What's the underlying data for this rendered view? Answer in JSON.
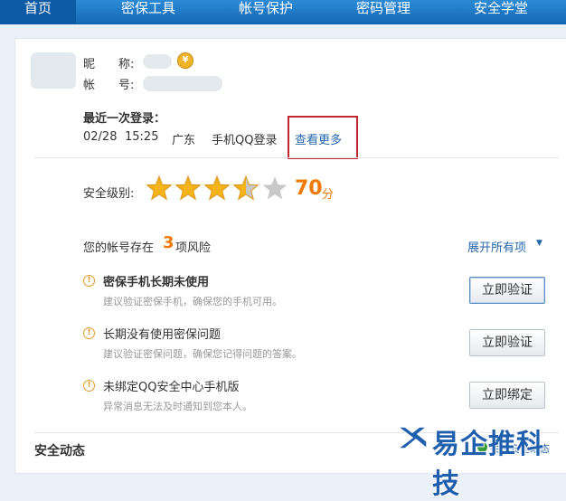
{
  "nav": {
    "items": [
      "首页",
      "密保工具",
      "帐号保护",
      "密码管理",
      "安全学堂"
    ],
    "active_index": 0
  },
  "profile": {
    "nickname_label": "昵　　称:",
    "account_label": "帐　　号:"
  },
  "last_login": {
    "title": "最近一次登录：",
    "date": "02/28",
    "time": "15:25",
    "location": "广东",
    "device": "手机QQ登录",
    "more_link": "查看更多"
  },
  "security": {
    "level_label": "安全级别:",
    "score": "70",
    "score_unit": "分",
    "stars_total": 5,
    "stars_rating": 3.5
  },
  "risks": {
    "prefix": "您的帐号存在",
    "count": "3",
    "suffix": "项风险",
    "expand_all": "展开所有项",
    "items": [
      {
        "title": "密保手机长期未使用",
        "desc": "建议验证密保手机，确保您的手机可用。",
        "button": "立即验证"
      },
      {
        "title": "长期没有使用密保问题",
        "desc": "建议验证密保问题，确保您记得问题的答案。",
        "button": "立即验证"
      },
      {
        "title": "未绑定QQ安全中心手机版",
        "desc": "异常消息无法及时通知到您本人。",
        "button": "立即绑定"
      }
    ]
  },
  "dynamics": {
    "title": "安全动态",
    "right_link": "关注安全动态"
  },
  "watermark": {
    "text": "易企推科技",
    "colors": [
      "#1f5fae",
      "#ffffff"
    ]
  },
  "colors": {
    "nav_bg": "#1a74c4",
    "score_orange": "#f27a00",
    "link_blue": "#2466ad",
    "highlight_red": "#c0262d",
    "star_gold": "#f5b31a",
    "star_gray": "#c8c8c8"
  }
}
